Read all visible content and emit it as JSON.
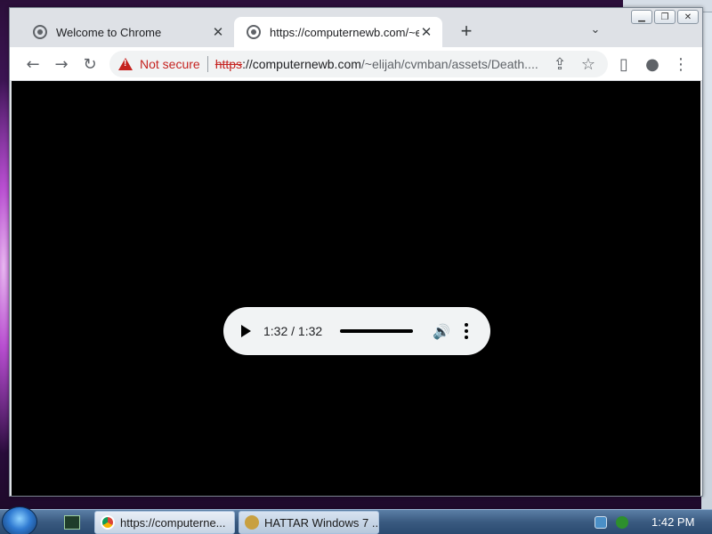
{
  "browser": {
    "tabs": [
      {
        "title": "Welcome to Chrome",
        "close": "✕"
      },
      {
        "title": "https://computernewb.com/~elija",
        "close": "✕"
      }
    ],
    "new_tab_glyph": "+",
    "tab_search_glyph": "⌄",
    "toolbar": {
      "back_glyph": "←",
      "forward_glyph": "→",
      "reload_glyph": "↻",
      "not_secure": "Not secure",
      "url_scheme": "https",
      "url_host": "://computernewb.com",
      "url_path": "/~elijah/cvmban/assets/Death....",
      "share_glyph": "⇪",
      "bookmark_glyph": "☆",
      "sidepanel_glyph": "▯",
      "profile_glyph": "●",
      "menu_glyph": "⋮"
    },
    "window_controls": {
      "minimize": "▁",
      "restore": "❐",
      "close": "✕"
    }
  },
  "media_player": {
    "time": "1:32 / 1:32",
    "progress": 1.0,
    "volume_glyph": "🔊"
  },
  "taskbar": {
    "tasks": [
      {
        "label": "https://computerne..."
      },
      {
        "label": "HATTAR Windows 7 ..."
      }
    ],
    "clock": "1:42 PM"
  },
  "colors": {
    "not_secure": "#c5221f",
    "video_bg": "#000000",
    "player_bg": "#f1f3f4"
  }
}
